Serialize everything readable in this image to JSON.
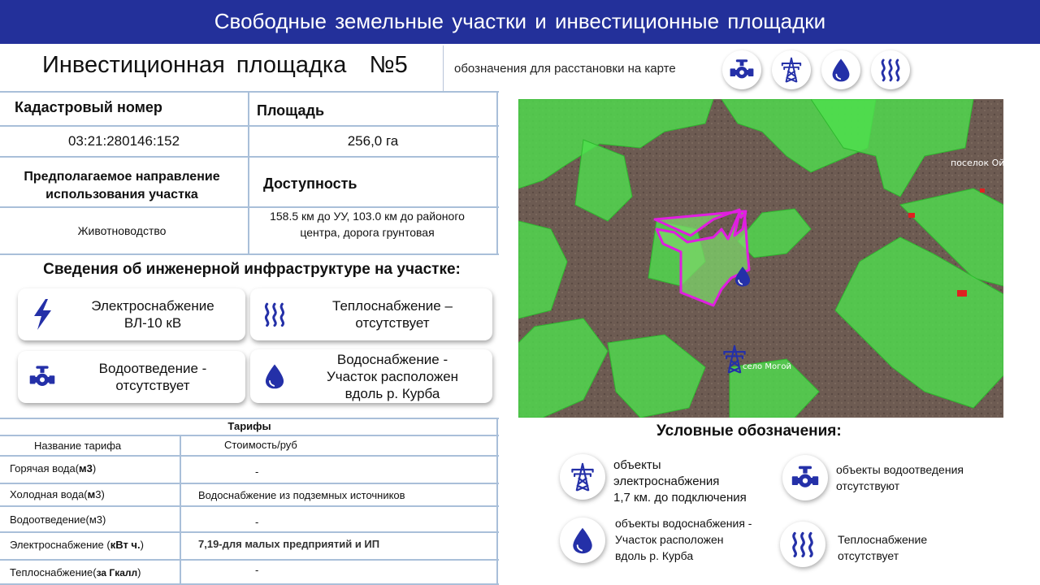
{
  "banner": {
    "title": "Свободные земельные участки и инвестиционные площадки"
  },
  "site": {
    "title": "Инвестиционная площадка  №5",
    "legend_hint": "обозначения для расстановки на карте",
    "header_icons": [
      "valve-icon",
      "power-tower-icon",
      "water-drop-icon",
      "heat-waves-icon"
    ]
  },
  "info": {
    "cadastral_label": "Кадастровый номер",
    "area_label": "Площадь",
    "cadastral_value": "03:21:280146:152",
    "area_value": "256,0 га",
    "purpose_label_line1": "Предполагаемое направление",
    "purpose_label_line2": "использования участка",
    "access_label": "Доступность",
    "purpose_value": "Животноводство",
    "access_value_line1": "158.5 км до УУ, 103.0 км до районого",
    "access_value_line2": "центра, дорога грунтовая"
  },
  "infrastructure": {
    "title": "Сведения об инженерной инфраструктуре на участке:",
    "cards": [
      {
        "icon": "lightning-icon",
        "line1": "Электроснабжение",
        "line2": "ВЛ-10 кВ"
      },
      {
        "icon": "heat-waves-icon",
        "line1": "Теплоснабжение –",
        "line2": "отсутствует"
      },
      {
        "icon": "valve-icon",
        "line1": "Водоотведение -",
        "line2": "отсутствует"
      },
      {
        "icon": "water-drop-icon",
        "line1": "Водоснабжение -",
        "line2": "Участок расположен",
        "line3": "вдоль р. Курба"
      }
    ]
  },
  "tariffs": {
    "title": "Тарифы",
    "col_name": "Название тарифа",
    "col_cost": "Стоимость/руб",
    "rows": [
      {
        "name": "Горячая вода(",
        "unit": "м3",
        "tail": ")",
        "value": "-"
      },
      {
        "name": "Холодная вода(",
        "unit": "м",
        "tail": "3)",
        "value": "Водоснабжение из подземных источников"
      },
      {
        "name": "Водоотведение(",
        "unit": "м3",
        "tail": ")",
        "value": "-"
      },
      {
        "name": "Электроснабжение (",
        "unit": "кВт ч.",
        "tail": ")",
        "value": "7,19-для малых предприятий и ИП"
      },
      {
        "name": "Теплоснабжение(",
        "unit": "за Гкалл",
        "tail": ")",
        "value": "-"
      }
    ]
  },
  "map": {
    "label_settlement": "поселок Ой",
    "label_village": "село Могой",
    "colors": {
      "plot_outline": "#e01ee0",
      "green_zone": "#4ee04e",
      "icon_blue": "#2430a8"
    }
  },
  "legend": {
    "title": "Условные обозначения:",
    "items": [
      {
        "icon": "power-tower-icon",
        "line1": "объекты",
        "line2": "электроснабжения",
        "line3": "1,7 км. до подключения"
      },
      {
        "icon": "valve-icon",
        "line1": "объекты водоотведения",
        "line2": "отсутствуют"
      },
      {
        "icon": "water-drop-icon",
        "line1": "объекты водоснабжения -",
        "line2": "Участок расположен",
        "line3": "вдоль р. Курба"
      },
      {
        "icon": "heat-waves-icon",
        "line1": "Теплоснабжение",
        "line2": "отсутствует"
      }
    ]
  }
}
